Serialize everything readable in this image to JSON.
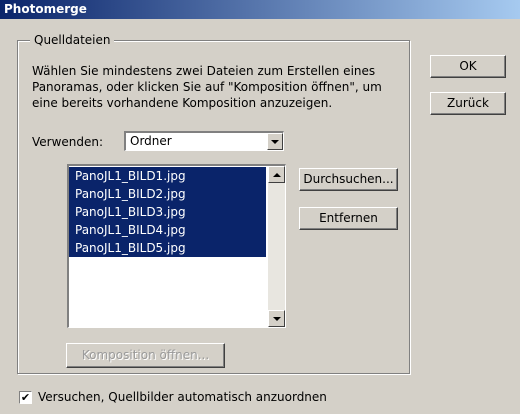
{
  "window": {
    "title": "Photomerge"
  },
  "source_group": {
    "legend": "Quelldateien",
    "instructions": "Wählen Sie mindestens zwei Dateien zum Erstellen eines\nPanoramas, oder klicken Sie auf \"Komposition öffnen\", um\neine bereits vorhandene Komposition anzuzeigen.",
    "use_label": "Verwenden:",
    "use_value": "Ordner",
    "files": [
      "PanoJL1_BILD1.jpg",
      "PanoJL1_BILD2.jpg",
      "PanoJL1_BILD3.jpg",
      "PanoJL1_BILD4.jpg",
      "PanoJL1_BILD5.jpg"
    ],
    "browse_label": "Durchsuchen...",
    "remove_label": "Entfernen",
    "open_composition_label": "Komposition öffnen..."
  },
  "buttons": {
    "ok_label": "OK",
    "back_label": "Zurück"
  },
  "auto_arrange": {
    "checked": true,
    "label": "Versuchen, Quellbilder automatisch anzuordnen",
    "check_mark": "✔"
  },
  "colors": {
    "dialog_bg": "#d4d0c8",
    "selection_bg": "#0a246a",
    "title_gradient_start": "#0a246a",
    "title_gradient_end": "#a6caf0"
  }
}
